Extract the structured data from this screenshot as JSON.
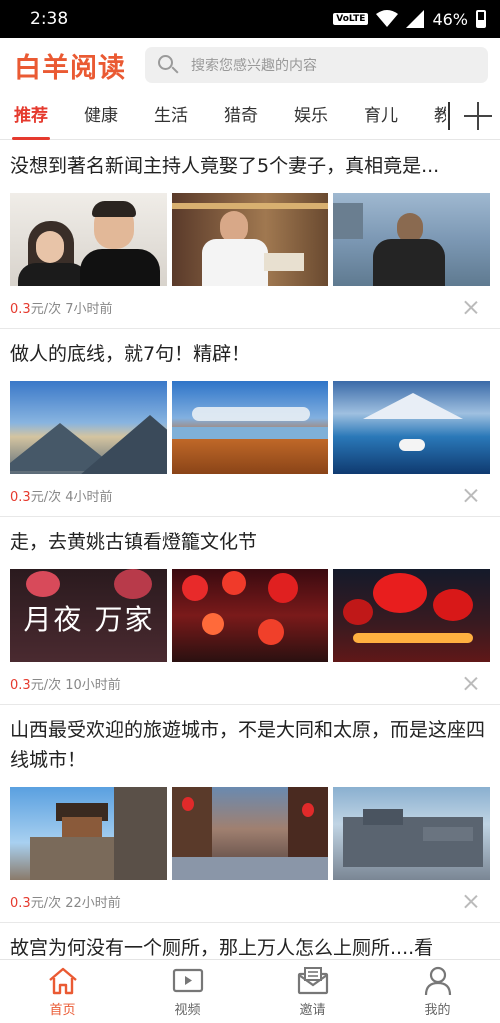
{
  "status": {
    "time": "2:38",
    "network": "VoLTE",
    "battery": "46%"
  },
  "header": {
    "logo": "白羊阅读",
    "search_placeholder": "搜索您感兴趣的内容"
  },
  "tabs": [
    {
      "label": "推荐",
      "active": true
    },
    {
      "label": "健康"
    },
    {
      "label": "生活"
    },
    {
      "label": "猎奇"
    },
    {
      "label": "娱乐"
    },
    {
      "label": "育儿"
    },
    {
      "label": "教"
    }
  ],
  "articles": [
    {
      "title": "没想到著名新闻主持人竟娶了5个妻子，真相竟是...",
      "price": "0.3",
      "unit": "元/次",
      "time": "7小时前"
    },
    {
      "title": "做人的底线，就7句！精辟！",
      "price": "0.3",
      "unit": "元/次",
      "time": "4小时前"
    },
    {
      "title": "走，去黄姚古镇看燈籠文化节",
      "price": "0.3",
      "unit": "元/次",
      "time": "10小时前",
      "image_text": "月夜 万家"
    },
    {
      "title": "山西最受欢迎的旅遊城市，不是大同和太原，而是这座四线城市！",
      "price": "0.3",
      "unit": "元/次",
      "time": "22小时前"
    },
    {
      "title": "故宫为何没有一个厕所，那上万人怎么上厕所....看"
    }
  ],
  "bottom_nav": [
    {
      "label": "首页",
      "icon": "home-icon",
      "active": true
    },
    {
      "label": "视频",
      "icon": "video-icon"
    },
    {
      "label": "邀请",
      "icon": "invite-icon"
    },
    {
      "label": "我的",
      "icon": "profile-icon"
    }
  ],
  "colors": {
    "brand": "#ea5a33",
    "accent": "#e53a2e"
  }
}
